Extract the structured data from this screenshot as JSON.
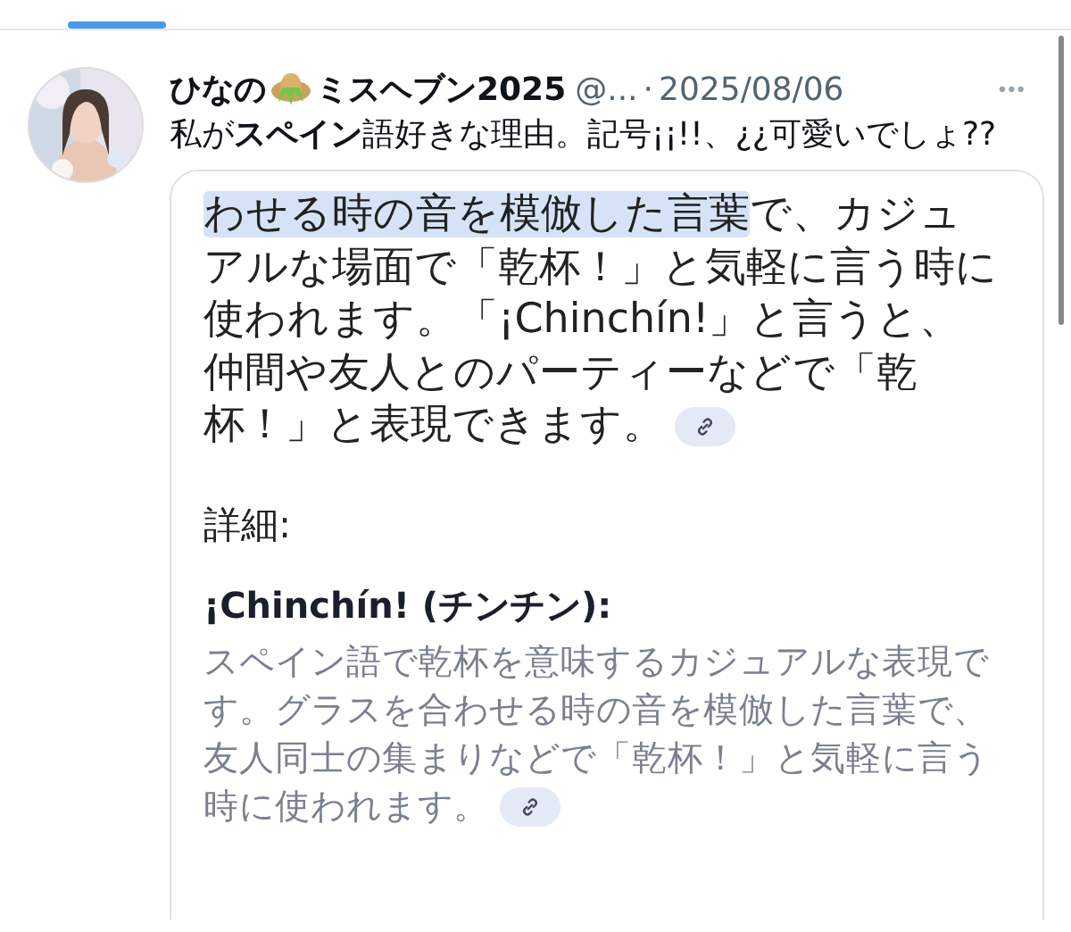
{
  "tabs": [
    {
      "selected": true
    }
  ],
  "post": {
    "author_name_before": "ひなの",
    "author_name_after": "ミスヘブン2025",
    "handle": "@...",
    "separator": "·",
    "date": "2025/08/06",
    "more": "•••",
    "text": "私が**スペイン**語好きな理由。記号¡¡!!、¿¿可愛いでしょ??",
    "attached_screenshot": {
      "paragraph": [
        {
          "text": "わせる時の音を模倣した言葉",
          "highlighted": true
        },
        {
          "text": "で、カジュアルな場面で「乾杯！」と気軽に言う時に使われます。「¡Chinchín!」と言うと、仲間や友人とのパーティーなどで「乾杯！」と表現できます。",
          "highlighted": false
        }
      ],
      "section_label": "詳細:",
      "term": "¡Chinchín! (チンチン):",
      "definition": "スペイン語で乾杯を意味するカジュアルな表現です。グラスを合わせる時の音を模倣した言葉で、友人同士の集まりなどで「乾杯！」と気軽に言う時に使われます。"
    }
  }
}
